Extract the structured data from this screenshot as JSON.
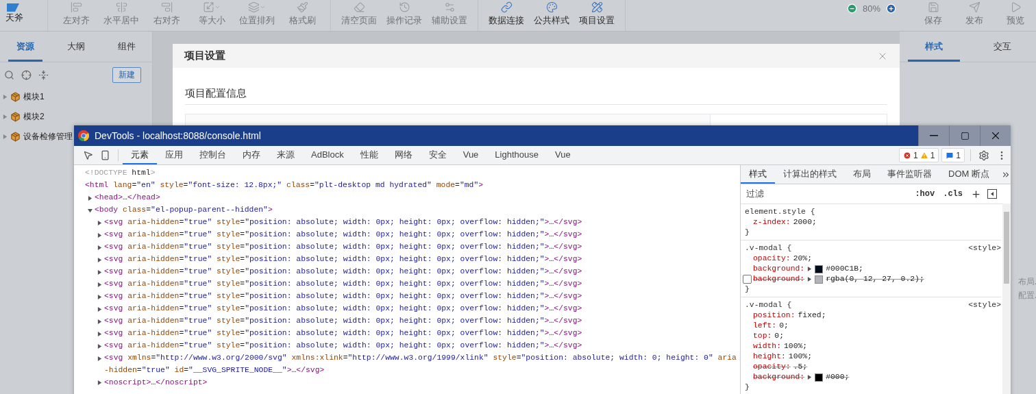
{
  "toolbar": {
    "logo": "天斧",
    "groups": [
      {
        "buttons": [
          {
            "label": "左对齐",
            "disabled": true,
            "dropdown": false
          },
          {
            "label": "水平居中",
            "disabled": true,
            "dropdown": false
          },
          {
            "label": "右对齐",
            "disabled": true,
            "dropdown": false
          },
          {
            "label": "等大小",
            "disabled": true,
            "dropdown": true
          },
          {
            "label": "位置排列",
            "disabled": true,
            "dropdown": true
          },
          {
            "label": "格式刷",
            "disabled": true,
            "dropdown": false
          }
        ]
      },
      {
        "buttons": [
          {
            "label": "清空页面",
            "disabled": true,
            "dropdown": false
          },
          {
            "label": "操作记录",
            "disabled": true,
            "dropdown": false
          },
          {
            "label": "辅助设置",
            "disabled": true,
            "dropdown": false
          }
        ]
      },
      {
        "buttons": [
          {
            "label": "数据连接",
            "disabled": false,
            "dropdown": false
          },
          {
            "label": "公共样式",
            "disabled": false,
            "dropdown": false
          },
          {
            "label": "项目设置",
            "disabled": false,
            "dropdown": false
          }
        ]
      }
    ],
    "zoom": "80%",
    "actions": [
      {
        "label": "保存",
        "disabled": true
      },
      {
        "label": "发布",
        "disabled": true
      },
      {
        "label": "预览",
        "disabled": true
      }
    ]
  },
  "left_panel": {
    "tabs": [
      {
        "label": "资源",
        "selected": true
      },
      {
        "label": "大纲",
        "selected": false
      },
      {
        "label": "组件",
        "selected": false
      }
    ],
    "new_button": "新建",
    "tree": [
      {
        "label": "模块1",
        "expanded": false
      },
      {
        "label": "模块2",
        "expanded": false
      },
      {
        "label": "设备检修管理",
        "expanded": false
      }
    ]
  },
  "modal": {
    "title": "项目设置",
    "section_title": "项目配置信息"
  },
  "right_panel": {
    "tabs": [
      {
        "label": "样式",
        "selected": true
      },
      {
        "label": "交互",
        "selected": false
      }
    ],
    "fragments": [
      "布局.",
      "配置."
    ]
  },
  "devtools": {
    "title": "DevTools - localhost:8088/console.html",
    "tabs": [
      {
        "label": "元素",
        "selected": true
      },
      {
        "label": "应用",
        "selected": false
      },
      {
        "label": "控制台",
        "selected": false
      },
      {
        "label": "内存",
        "selected": false
      },
      {
        "label": "来源",
        "selected": false
      },
      {
        "label": "AdBlock",
        "selected": false
      },
      {
        "label": "性能",
        "selected": false
      },
      {
        "label": "网络",
        "selected": false
      },
      {
        "label": "安全",
        "selected": false
      },
      {
        "label": "Vue",
        "selected": false
      },
      {
        "label": "Lighthouse",
        "selected": false
      },
      {
        "label": "Vue",
        "selected": false
      }
    ],
    "errors": "1",
    "warnings": "1",
    "messages": "1",
    "dom": [
      {
        "text": "<!DOCTYPE html>"
      },
      {
        "text": "<html lang=\"en\" style=\"font-size: 12.8px;\" class=\"plt-desktop md hydrated\" mode=\"md\">",
        "children": [
          {
            "text": "<head>…</head>",
            "expanded": false
          },
          {
            "text": "<body class=\"el-popup-parent--hidden\">",
            "expanded": true,
            "children": [
              {
                "text": "<svg aria-hidden=\"true\" style=\"position: absolute; width: 0px; height: 0px; overflow: hidden;\">…</svg>",
                "expanded": false
              },
              {
                "text": "<svg aria-hidden=\"true\" style=\"position: absolute; width: 0px; height: 0px; overflow: hidden;\">…</svg>",
                "expanded": false
              },
              {
                "text": "<svg aria-hidden=\"true\" style=\"position: absolute; width: 0px; height: 0px; overflow: hidden;\">…</svg>",
                "expanded": false
              },
              {
                "text": "<svg aria-hidden=\"true\" style=\"position: absolute; width: 0px; height: 0px; overflow: hidden;\">…</svg>",
                "expanded": false
              },
              {
                "text": "<svg aria-hidden=\"true\" style=\"position: absolute; width: 0px; height: 0px; overflow: hidden;\">…</svg>",
                "expanded": false
              },
              {
                "text": "<svg aria-hidden=\"true\" style=\"position: absolute; width: 0px; height: 0px; overflow: hidden;\">…</svg>",
                "expanded": false
              },
              {
                "text": "<svg aria-hidden=\"true\" style=\"position: absolute; width: 0px; height: 0px; overflow: hidden;\">…</svg>",
                "expanded": false
              },
              {
                "text": "<svg aria-hidden=\"true\" style=\"position: absolute; width: 0px; height: 0px; overflow: hidden;\">…</svg>",
                "expanded": false
              },
              {
                "text": "<svg aria-hidden=\"true\" style=\"position: absolute; width: 0px; height: 0px; overflow: hidden;\">…</svg>",
                "expanded": false
              },
              {
                "text": "<svg aria-hidden=\"true\" style=\"position: absolute; width: 0px; height: 0px; overflow: hidden;\">…</svg>",
                "expanded": false
              },
              {
                "text": "<svg aria-hidden=\"true\" style=\"position: absolute; width: 0px; height: 0px; overflow: hidden;\">…</svg>",
                "expanded": false
              },
              {
                "text": "<svg xmlns=\"http://www.w3.org/2000/svg\" xmlns:xlink=\"http://www.w3.org/1999/xlink\" style=\"position: absolute; width: 0; height: 0\" aria-hidden=\"true\" id=\"__SVG_SPRITE_NODE__\">…</svg>",
                "expanded": false
              },
              {
                "text": "<noscript>…</noscript>",
                "expanded": false
              }
            ]
          }
        ]
      }
    ],
    "styles_tabs": [
      {
        "label": "样式",
        "selected": true
      },
      {
        "label": "计算出的样式",
        "selected": false
      },
      {
        "label": "布局",
        "selected": false
      },
      {
        "label": "事件监听器",
        "selected": false
      },
      {
        "label": "DOM 断点",
        "selected": false
      }
    ],
    "filter_placeholder": "过滤",
    "hov": ":hov",
    "cls": ".cls",
    "rules": [
      {
        "selector": "element.style {",
        "close": "}",
        "props": [
          {
            "name": "z-index:",
            "value": "2000;",
            "overridden": false
          }
        ]
      },
      {
        "selector": ".v-modal {",
        "source": "<style>",
        "close": "}",
        "props": [
          {
            "name": "opacity:",
            "value": "20%;",
            "overridden": false
          },
          {
            "name": "background:",
            "value": "#000C1B;",
            "color": "#000c1b",
            "overridden": false
          },
          {
            "name": "background:",
            "value": "rgba(0, 12, 27, 0.2);",
            "color": "#b0b4b9",
            "overridden": true,
            "checked": false
          }
        ]
      },
      {
        "selector": ".v-modal {",
        "source": "<style>",
        "close": "}",
        "props": [
          {
            "name": "position:",
            "value": "fixed;",
            "overridden": false
          },
          {
            "name": "left:",
            "value": "0;",
            "overridden": false
          },
          {
            "name": "top:",
            "value": "0;",
            "overridden": false
          },
          {
            "name": "width:",
            "value": "100%;",
            "overridden": false
          },
          {
            "name": "height:",
            "value": "100%;",
            "overridden": false
          },
          {
            "name": "opacity:",
            "value": ".5;",
            "overridden": true
          },
          {
            "name": "background:",
            "value": "#000;",
            "color": "#000000",
            "overridden": true
          }
        ]
      }
    ]
  }
}
